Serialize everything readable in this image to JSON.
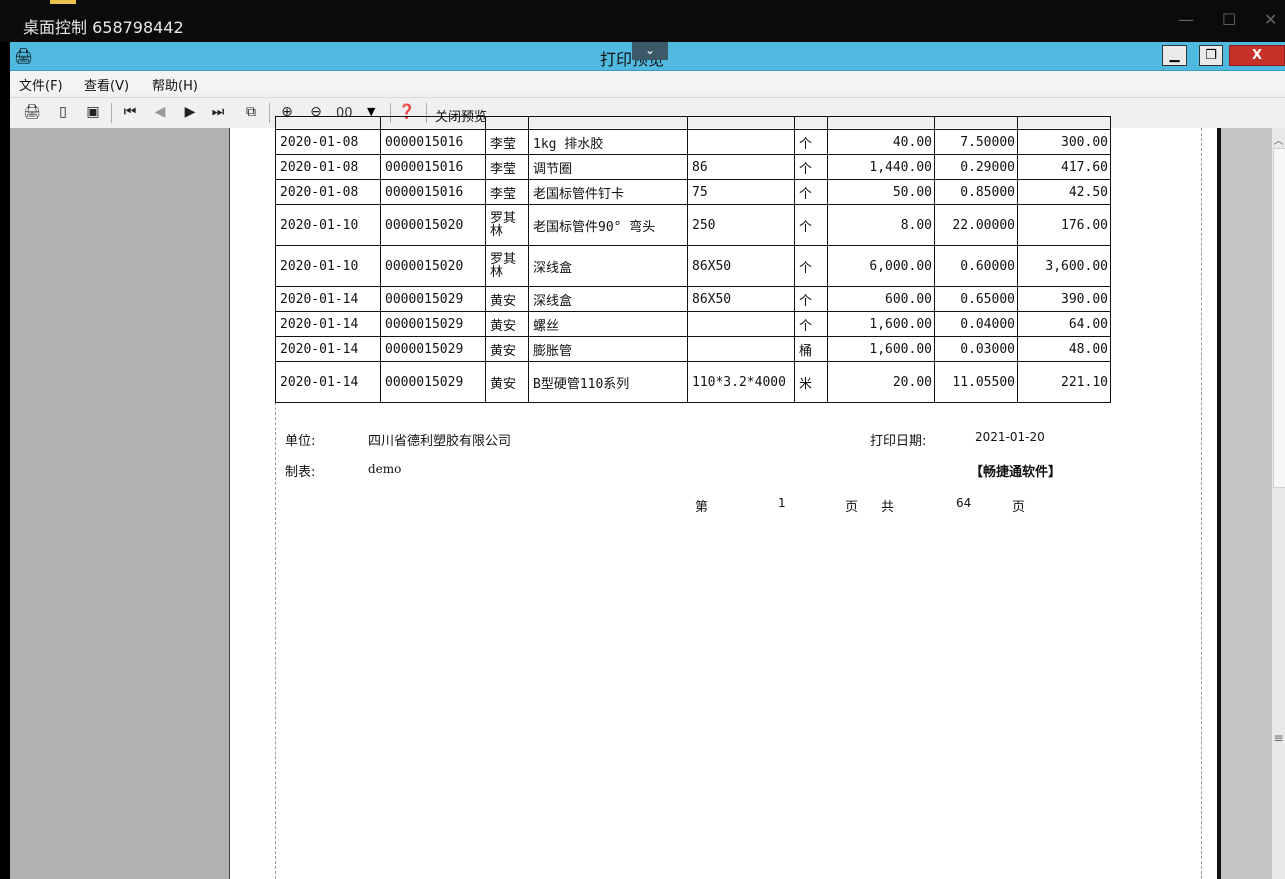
{
  "remote": {
    "title": "桌面控制 658798442",
    "min": "—",
    "max": "☐",
    "close": "✕"
  },
  "window": {
    "title": "打印预览",
    "dropdown": "⌄",
    "min": "▁",
    "restore": "❐",
    "close": "X",
    "icon": "printer-icon"
  },
  "menu": {
    "file": "文件(F)",
    "view": "查看(V)",
    "help": "帮助(H)"
  },
  "toolbar": {
    "zoom_value": "00",
    "close_preview": "关闭预览"
  },
  "table": {
    "rows": [
      {
        "date": "2020-01-08",
        "no": "0000015016",
        "person": "李莹",
        "item": "1kg 排水胶",
        "spec": "",
        "unit": "个",
        "qty": "40.00",
        "price": "7.50000",
        "amount": "300.00"
      },
      {
        "date": "2020-01-08",
        "no": "0000015016",
        "person": "李莹",
        "item": "调节圈",
        "spec": "86",
        "unit": "个",
        "qty": "1,440.00",
        "price": "0.29000",
        "amount": "417.60"
      },
      {
        "date": "2020-01-08",
        "no": "0000015016",
        "person": "李莹",
        "item": "老国标管件钉卡",
        "spec": "75",
        "unit": "个",
        "qty": "50.00",
        "price": "0.85000",
        "amount": "42.50"
      },
      {
        "date": "2020-01-10",
        "no": "0000015020",
        "person": "罗其林",
        "item": "老国标管件90° 弯头",
        "spec": "250",
        "unit": "个",
        "qty": "8.00",
        "price": "22.00000",
        "amount": "176.00"
      },
      {
        "date": "2020-01-10",
        "no": "0000015020",
        "person": "罗其林",
        "item": "深线盒",
        "spec": "86X50",
        "unit": "个",
        "qty": "6,000.00",
        "price": "0.60000",
        "amount": "3,600.00"
      },
      {
        "date": "2020-01-14",
        "no": "0000015029",
        "person": "黄安",
        "item": "深线盒",
        "spec": "86X50",
        "unit": "个",
        "qty": "600.00",
        "price": "0.65000",
        "amount": "390.00"
      },
      {
        "date": "2020-01-14",
        "no": "0000015029",
        "person": "黄安",
        "item": "螺丝",
        "spec": "",
        "unit": "个",
        "qty": "1,600.00",
        "price": "0.04000",
        "amount": "64.00"
      },
      {
        "date": "2020-01-14",
        "no": "0000015029",
        "person": "黄安",
        "item": "膨胀管",
        "spec": "",
        "unit": "桶",
        "qty": "1,600.00",
        "price": "0.03000",
        "amount": "48.00"
      },
      {
        "date": "2020-01-14",
        "no": "0000015029",
        "person": "黄安",
        "item": "B型硬管110系列",
        "spec": "110*3.2*4000",
        "unit": "米",
        "qty": "20.00",
        "price": "11.05500",
        "amount": "221.10"
      }
    ]
  },
  "footer": {
    "unit_label": "单位:",
    "unit_value": "四川省德利塑胶有限公司",
    "print_date_label": "打印日期:",
    "print_date_value": "2021-01-20",
    "maker_label": "制表:",
    "maker_value": "demo",
    "software_brand": "【畅捷通软件】",
    "page_di": "第",
    "page_num": "1",
    "page_ye1": "页",
    "page_gong": "共",
    "page_total": "64",
    "page_ye2": "页"
  }
}
